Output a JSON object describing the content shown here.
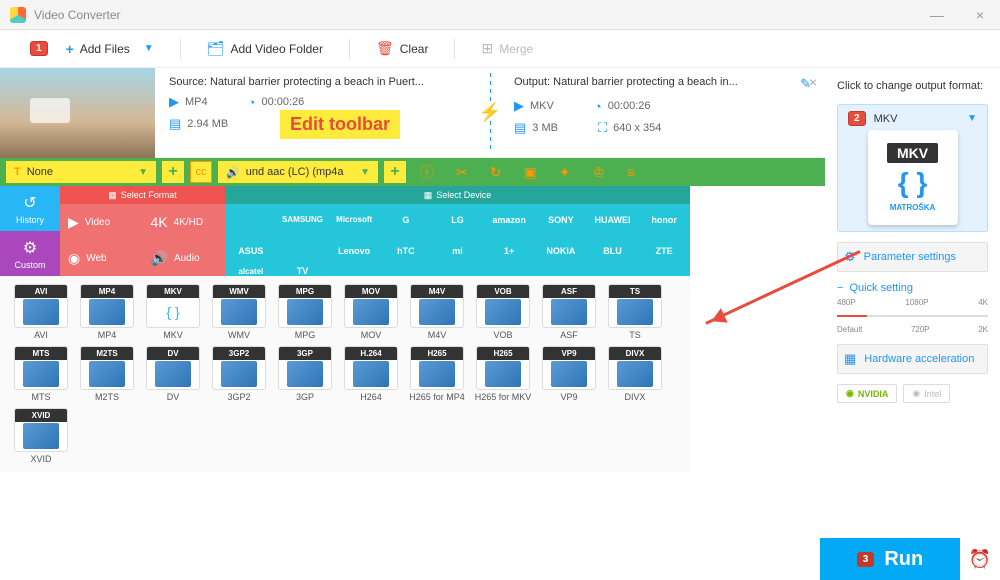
{
  "app": {
    "title": "Video Converter"
  },
  "toolbar": {
    "add_files": "Add Files",
    "add_folder": "Add Video Folder",
    "clear": "Clear",
    "merge": "Merge"
  },
  "badges": {
    "b1": "1",
    "b2": "2",
    "b3": "3"
  },
  "annotation": "Edit toolbar",
  "file": {
    "source_label": "Source: Natural barrier protecting a beach in Puert...",
    "output_label": "Output: Natural barrier protecting a beach in...",
    "src_format": "MP4",
    "src_dur": "00:00:26",
    "src_size": "2.94 MB",
    "out_format": "MKV",
    "out_dur": "00:00:26",
    "out_res": "640 x 354",
    "out_size": "3 MB"
  },
  "edit": {
    "subtitle": "None",
    "audio": "und aac (LC) (mp4a"
  },
  "panels": {
    "format_header": "Select Format",
    "device_header": "Select Device"
  },
  "tabs": {
    "history": "History",
    "custom": "Custom"
  },
  "cats": {
    "video": "Video",
    "hd": "4K/HD",
    "web": "Web",
    "audio": "Audio"
  },
  "brands": [
    "",
    "SAMSUNG",
    "Microsoft",
    "G",
    "LG",
    "amazon",
    "SONY",
    "HUAWEI",
    "honor",
    "ASUS",
    "",
    "Lenovo",
    "hTC",
    "mi",
    "1+",
    "NOKIA",
    "BLU",
    "ZTE",
    "alcatel",
    "TV"
  ],
  "formats": [
    "AVI",
    "MP4",
    "MKV",
    "WMV",
    "MPG",
    "MOV",
    "M4V",
    "VOB",
    "ASF",
    "TS",
    "MTS",
    "M2TS",
    "DV",
    "3GP2",
    "3GP",
    "H264",
    "H265 for MP4",
    "H265 for MKV",
    "VP9",
    "DIVX",
    "XVID"
  ],
  "format_badges": [
    "AVI",
    "MP4",
    "MKV",
    "WMV",
    "MPG",
    "MOV",
    "M4V",
    "VOB",
    "ASF",
    "TS",
    "MTS",
    "M2TS",
    "DV",
    "3GP2",
    "3GP",
    "H.264",
    "H265",
    "H265",
    "VP9",
    "DIVX",
    "XVID"
  ],
  "sidebar": {
    "change_fmt": "Click to change output format:",
    "selected": "MKV",
    "matroska": "MATROŠKA",
    "params": "Parameter settings",
    "quick": "Quick setting",
    "q480": "480P",
    "q1080": "1080P",
    "q4k": "4K",
    "qdef": "Default",
    "q720": "720P",
    "q2k": "2K",
    "hw": "Hardware acceleration",
    "nvidia": "NVIDIA",
    "intel": "Intel",
    "run": "Run"
  }
}
